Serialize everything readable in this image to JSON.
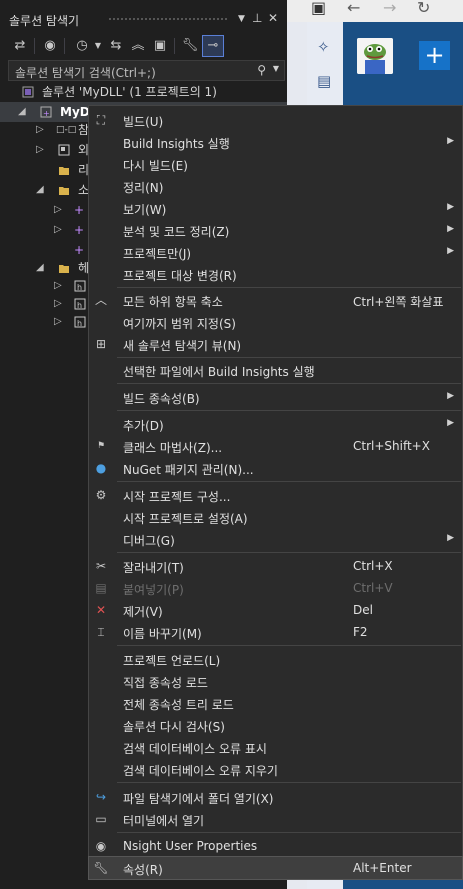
{
  "panel": {
    "title": "솔루션 탐색기",
    "title_icons": [
      "dropdown-icon",
      "pin-icon",
      "close-icon"
    ],
    "toolbar_icons": [
      "switch-views-icon",
      "globe-icon",
      "history-icon",
      "sync-icon",
      "collapse-icon",
      "show-all-icon",
      "properties-icon",
      "preview-icon"
    ],
    "search": {
      "placeholder": "솔루션 탐색기 검색(Ctrl+;)"
    },
    "solution_label": "솔루션 'MyDLL' (1 프로젝트의 1)",
    "tree": [
      {
        "label": "MyD",
        "icon": "project-icon"
      },
      {
        "label": "참",
        "icon": "references-icon"
      },
      {
        "label": "외",
        "icon": "external-icon"
      },
      {
        "label": "리",
        "icon": "folder-icon"
      },
      {
        "label": "소",
        "icon": "folder-icon"
      },
      {
        "label": "+",
        "icon": "cpp-file-icon"
      },
      {
        "label": "+",
        "icon": "cpp-file-icon"
      },
      {
        "label": "+",
        "icon": "cpp-file-icon"
      },
      {
        "label": "헤",
        "icon": "folder-icon"
      },
      {
        "label": "",
        "icon": "header-file-icon"
      },
      {
        "label": "",
        "icon": "header-file-icon"
      },
      {
        "label": "",
        "icon": "header-file-icon"
      }
    ]
  },
  "browser": {
    "nav_icons": [
      "back-icon",
      "forward-icon",
      "refresh-icon"
    ],
    "plus_label": "+"
  },
  "menu": {
    "items": [
      {
        "label": "빌드(U)",
        "shortcut": "",
        "icon": "build-icon"
      },
      {
        "label": "Build Insights 실행",
        "shortcut": "",
        "icon": ""
      },
      {
        "label": "다시 빌드(E)",
        "shortcut": "",
        "icon": ""
      },
      {
        "label": "정리(N)",
        "shortcut": "",
        "icon": ""
      },
      {
        "label": "보기(W)",
        "shortcut": "",
        "icon": ""
      },
      {
        "label": "분석 및 코드 정리(Z)",
        "shortcut": "",
        "icon": ""
      },
      {
        "label": "프로젝트만(J)",
        "shortcut": "",
        "icon": ""
      },
      {
        "label": "프로젝트 대상 변경(R)",
        "shortcut": "",
        "icon": ""
      },
      {
        "label": "모든 하위 항목 축소",
        "shortcut": "Ctrl+왼쪽 화살표",
        "icon": "collapse-icon"
      },
      {
        "label": "여기까지 범위 지정(S)",
        "shortcut": "",
        "icon": ""
      },
      {
        "label": "새 솔루션 탐색기 뷰(N)",
        "shortcut": "",
        "icon": "new-view-icon"
      },
      {
        "label": "선택한 파일에서 Build Insights 실행",
        "shortcut": "",
        "icon": ""
      },
      {
        "label": "빌드 종속성(B)",
        "shortcut": "",
        "icon": ""
      },
      {
        "label": "추가(D)",
        "shortcut": "",
        "icon": ""
      },
      {
        "label": "클래스 마법사(Z)...",
        "shortcut": "Ctrl+Shift+X",
        "icon": "class-wizard-icon"
      },
      {
        "label": "NuGet 패키지 관리(N)...",
        "shortcut": "",
        "icon": "nuget-icon"
      },
      {
        "label": "시작 프로젝트 구성...",
        "shortcut": "",
        "icon": "gear-icon"
      },
      {
        "label": "시작 프로젝트로 설정(A)",
        "shortcut": "",
        "icon": ""
      },
      {
        "label": "디버그(G)",
        "shortcut": "",
        "icon": ""
      },
      {
        "label": "잘라내기(T)",
        "shortcut": "Ctrl+X",
        "icon": "cut-icon"
      },
      {
        "label": "붙여넣기(P)",
        "shortcut": "Ctrl+V",
        "icon": "paste-icon"
      },
      {
        "label": "제거(V)",
        "shortcut": "Del",
        "icon": "remove-icon"
      },
      {
        "label": "이름 바꾸기(M)",
        "shortcut": "F2",
        "icon": "rename-icon"
      },
      {
        "label": "프로젝트 언로드(L)",
        "shortcut": "",
        "icon": ""
      },
      {
        "label": "직접 종속성 로드",
        "shortcut": "",
        "icon": ""
      },
      {
        "label": "전체 종속성 트리 로드",
        "shortcut": "",
        "icon": ""
      },
      {
        "label": "솔루션 다시 검사(S)",
        "shortcut": "",
        "icon": ""
      },
      {
        "label": "검색 데이터베이스 오류 표시",
        "shortcut": "",
        "icon": ""
      },
      {
        "label": "검색 데이터베이스 오류 지우기",
        "shortcut": "",
        "icon": ""
      },
      {
        "label": "파일 탐색기에서 폴더 열기(X)",
        "shortcut": "",
        "icon": "open-folder-icon"
      },
      {
        "label": "터미널에서 열기",
        "shortcut": "",
        "icon": "terminal-icon"
      },
      {
        "label": "Nsight User Properties",
        "shortcut": "",
        "icon": "nsight-icon"
      },
      {
        "label": "속성(R)",
        "shortcut": "Alt+Enter",
        "icon": "wrench-icon"
      }
    ]
  }
}
